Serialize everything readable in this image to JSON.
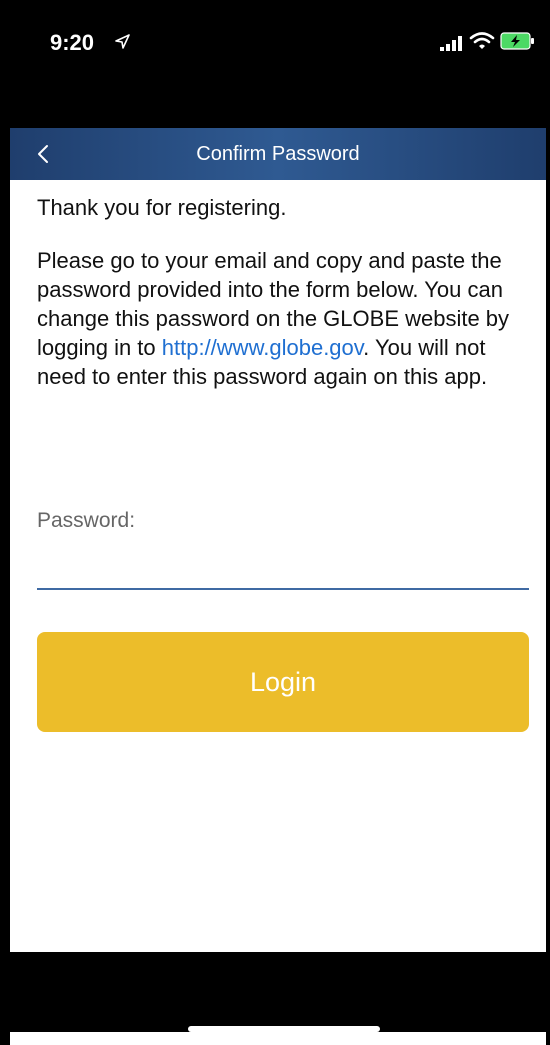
{
  "status_bar": {
    "time": "9:20",
    "icons": [
      "location-arrow-icon",
      "cellular-signal-icon",
      "wifi-icon",
      "battery-charging-icon"
    ]
  },
  "nav": {
    "title": "Confirm Password",
    "back_icon": "chevron-left-icon"
  },
  "content": {
    "thank_you": "Thank you for registering.",
    "instructions_before_link": "Please go to your email and copy and paste the password provided into the form below. You can change this password on the GLOBE website by logging in to ",
    "link_text": "http://www.globe.gov",
    "instructions_after_link": ". You will not need to enter this password again on this app."
  },
  "form": {
    "password_label": "Password:",
    "password_value": "",
    "login_label": "Login"
  },
  "colors": {
    "nav_bar": "#2a4f82",
    "link": "#1f6fd1",
    "login_button": "#ecbd2a",
    "input_underline": "#3f6aa3"
  }
}
